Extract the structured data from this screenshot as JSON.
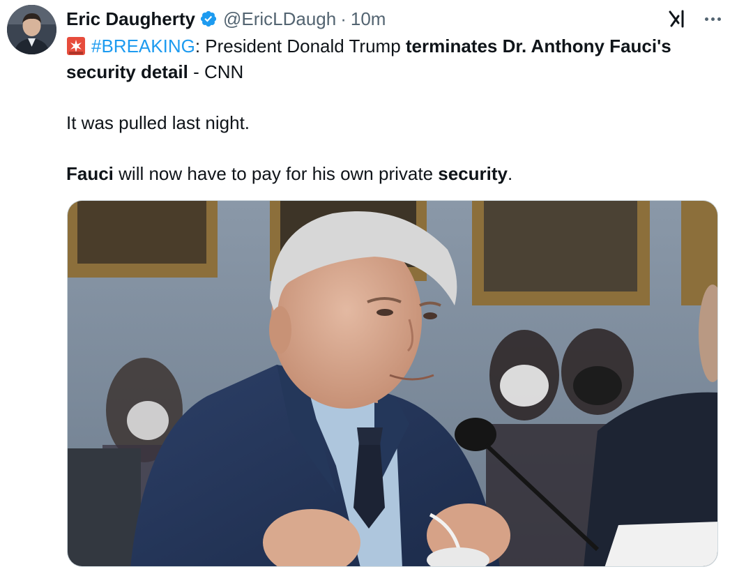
{
  "author": {
    "display_name": "Eric Daugherty",
    "handle": "@EricLDaugh",
    "separator": "·",
    "time": "10m",
    "verified": true,
    "verified_color": "#1d9bf0"
  },
  "header_actions": {
    "grok_icon": "grok-icon",
    "more_icon": "more-dots-icon"
  },
  "tweet": {
    "siren_icon": "police-light-emoji",
    "hashtag": "#BREAKING",
    "line1_colon": ":",
    "line1_plain": " President Donald Trump ",
    "line1_bold": "terminates Dr. Anthony Fauci's security detail",
    "line1_tail": " - CNN",
    "para2": "It was pulled last night.",
    "para3_bold1": "Fauci",
    "para3_plain": " will now have to pay for his own private ",
    "para3_bold2": "security",
    "para3_end": "."
  },
  "media": {
    "kind": "photo"
  },
  "colors": {
    "text": "#0f1419",
    "secondary": "#536471",
    "link": "#1d9bf0",
    "border": "#cfd9de"
  }
}
